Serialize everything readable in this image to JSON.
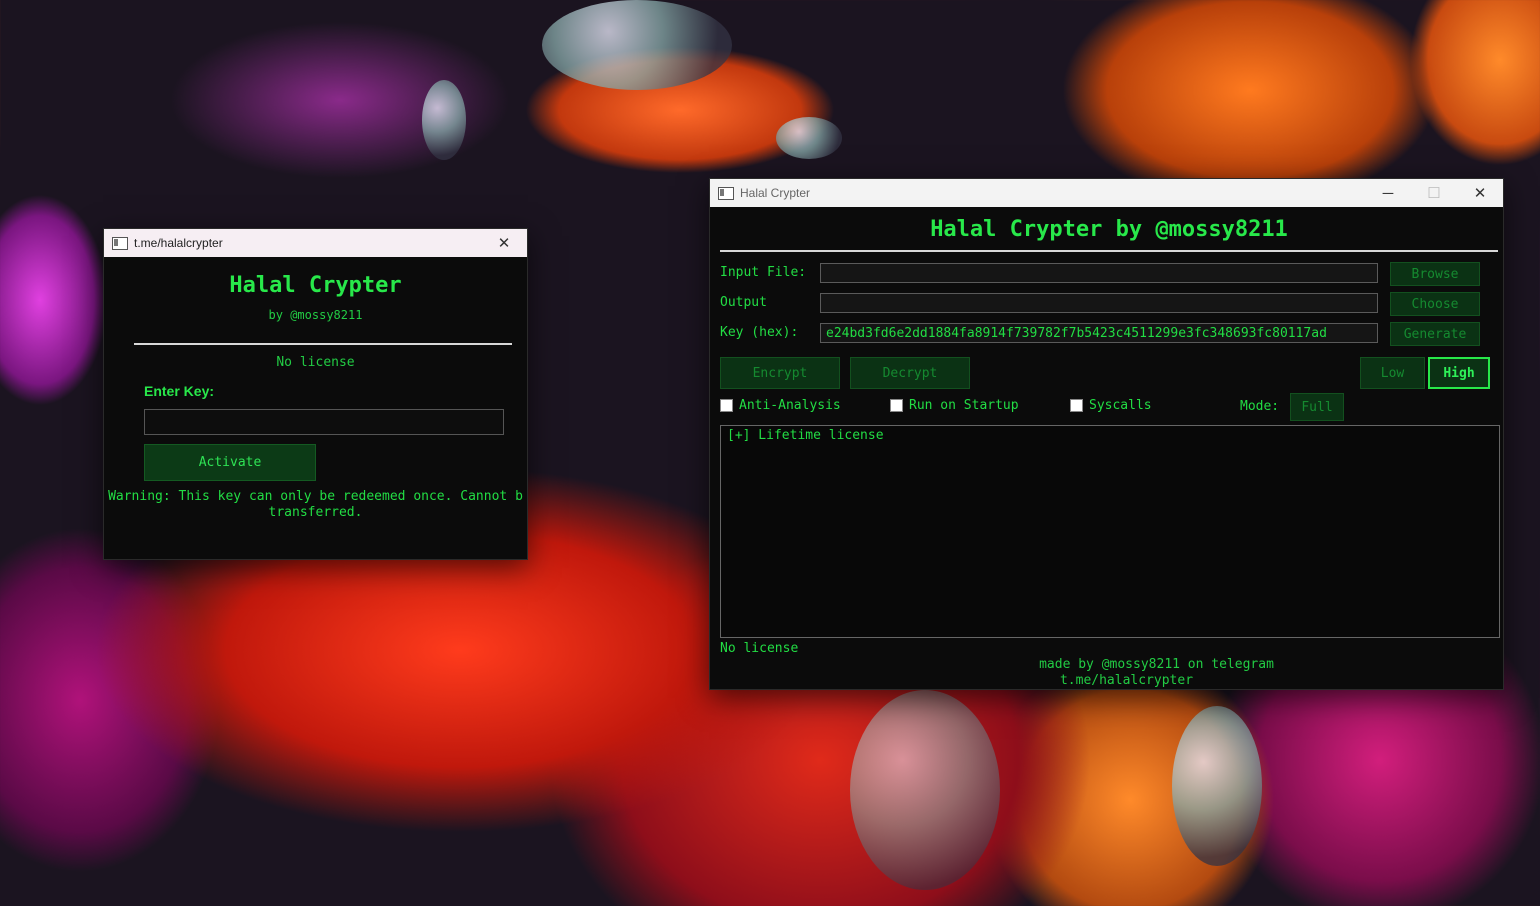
{
  "login_window": {
    "title": "t.me/halalcrypter",
    "heading": "Halal Crypter",
    "subheading": "by @mossy8211",
    "status": "No license",
    "key_label": "Enter Key:",
    "key_value": "",
    "activate_label": "Activate",
    "warning_line1": "Warning: This key can only be redeemed once. Cannot b",
    "warning_line2": "transferred."
  },
  "main_window": {
    "title": "Halal Crypter",
    "heading": "Halal Crypter by @mossy8211",
    "input_label": "Input File:",
    "input_value": "",
    "browse_label": "Browse",
    "output_label": "Output",
    "output_value": "",
    "choose_label": "Choose",
    "key_label": "Key (hex):",
    "key_value": "e24bd3fd6e2dd1884fa8914f739782f7b5423c4511299e3fc348693fc80117ad",
    "generate_label": "Generate",
    "encrypt_label": "Encrypt",
    "decrypt_label": "Decrypt",
    "low_label": "Low",
    "high_label": "High",
    "anti_analysis_label": "Anti-Analysis",
    "run_startup_label": "Run on Startup",
    "syscalls_label": "Syscalls",
    "mode_label": "Mode:",
    "mode_value": "Full",
    "log_text": "[+] Lifetime license",
    "status": "No license",
    "footer_line1": "made by @mossy8211 on telegram",
    "footer_line2": "t.me/halalcrypter"
  },
  "colors": {
    "accent_green": "#28e84a",
    "button_bg": "#0b3214",
    "window_bg": "#0b0b0b"
  },
  "icons": {
    "close": "close-icon",
    "minimize": "minimize-icon",
    "maximize": "maximize-icon"
  }
}
